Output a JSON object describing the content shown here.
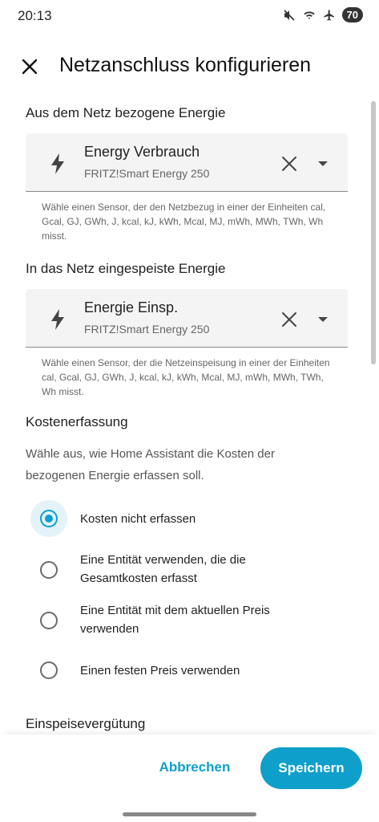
{
  "status_bar": {
    "time": "20:13",
    "battery": "70"
  },
  "header": {
    "title": "Netzanschluss konfigurieren"
  },
  "grid_consumption": {
    "label": "Aus dem Netz bezogene Energie",
    "entity_name": "Energy Verbrauch",
    "entity_device": "FRITZ!Smart Energy 250",
    "helper": "Wähle einen Sensor, der den Netzbezug in einer der Einheiten cal, Gcal, GJ, GWh, J, kcal, kJ, kWh, Mcal, MJ, mWh, MWh, TWh, Wh misst."
  },
  "grid_return": {
    "label": "In das Netz eingespeiste Energie",
    "entity_name": "Energie Einsp.",
    "entity_device": "FRITZ!Smart Energy 250",
    "helper": "Wähle einen Sensor, der die Netzeinspeisung in einer der Einheiten cal, Gcal, GJ, GWh, J, kcal, kJ, kWh, Mcal, MJ, mWh, MWh, TWh, Wh misst."
  },
  "cost": {
    "title": "Kostenerfassung",
    "description": "Wähle aus, wie Home Assistant die Kosten der bezogenen Energie erfassen soll.",
    "options": [
      {
        "label": "Kosten nicht erfassen",
        "checked": true
      },
      {
        "label": "Eine Entität verwenden, die die Gesamtkosten erfasst",
        "checked": false
      },
      {
        "label": "Eine Entität mit dem aktuellen Preis verwenden",
        "checked": false
      },
      {
        "label": "Einen festen Preis verwenden",
        "checked": false
      }
    ]
  },
  "feed_in": {
    "title": "Einspeisevergütung"
  },
  "actions": {
    "cancel": "Abbrechen",
    "save": "Speichern"
  },
  "colors": {
    "accent": "#0ea0cb",
    "field_bg": "#f4f4f4"
  },
  "icons": [
    "mute-icon",
    "wifi-icon",
    "airplane-icon",
    "close-icon",
    "flash-icon",
    "clear-icon",
    "dropdown-arrow-icon"
  ]
}
